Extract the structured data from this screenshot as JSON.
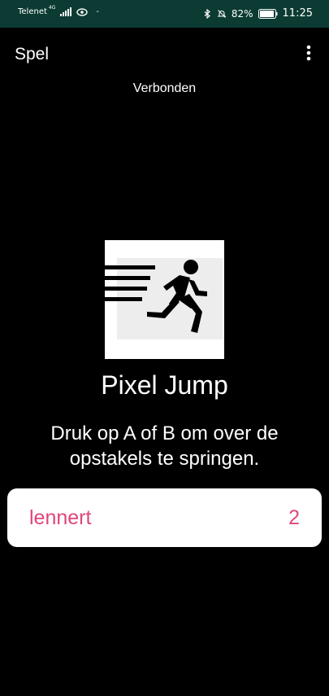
{
  "status_bar": {
    "carrier": "Telenet",
    "network_type": "4G",
    "signal_icon": "signal-bars-icon",
    "eye_icon": "eye-icon",
    "notification_dash": "-",
    "bluetooth_icon": "bluetooth-icon",
    "mute_icon": "bell-off-icon",
    "battery_percent": "82%",
    "battery_icon": "battery-icon",
    "time": "11:25",
    "background_color": "#0b3b33"
  },
  "app_bar": {
    "title": "Spel",
    "menu_icon": "more-vert-icon"
  },
  "connection": {
    "status": "Verbonden"
  },
  "game": {
    "image_icon": "running-person-icon",
    "title": "Pixel Jump",
    "instructions": "Druk op A of B om over de opstakels te springen."
  },
  "player": {
    "name": "lennert",
    "score": "2",
    "accent_color": "#e0457b"
  }
}
